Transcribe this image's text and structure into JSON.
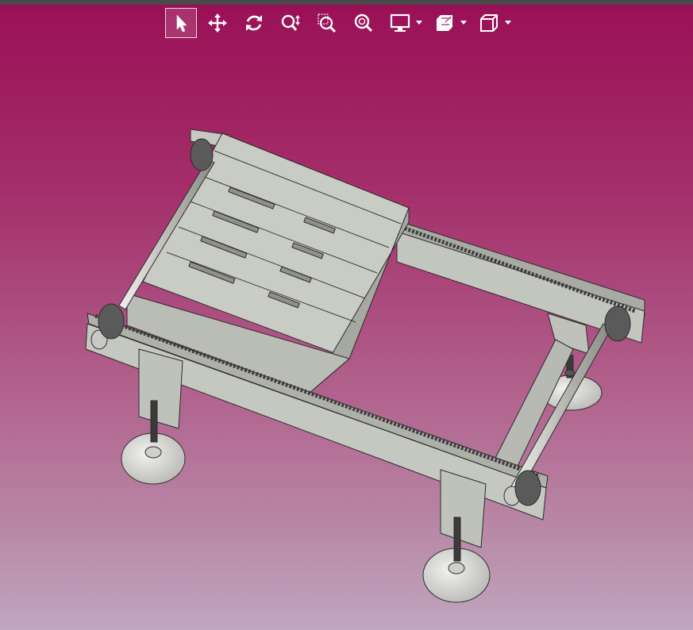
{
  "toolbar": {
    "tools": [
      {
        "icon": "select-arrow-icon",
        "active": true
      },
      {
        "icon": "pan-move-icon",
        "active": false
      },
      {
        "icon": "rotate-icon",
        "active": false
      },
      {
        "icon": "zoom-icon",
        "active": false
      },
      {
        "icon": "zoom-window-icon",
        "active": false
      },
      {
        "icon": "zoom-fit-icon",
        "active": false
      },
      {
        "icon": "display-mode-icon",
        "active": false,
        "dropdown": true
      },
      {
        "icon": "section-view-icon",
        "active": false,
        "dropdown": true
      },
      {
        "icon": "view-orientation-cube-icon",
        "active": false,
        "dropdown": true
      }
    ],
    "icon_color": "#ffffff"
  },
  "viewport": {
    "model": "roller-chain-conveyor-with-pallet",
    "background_top": "#9a0f56",
    "background_bottom": "#c0a6bf",
    "part_color": "#c9cbc5",
    "edge_color": "#2c2c2c"
  }
}
